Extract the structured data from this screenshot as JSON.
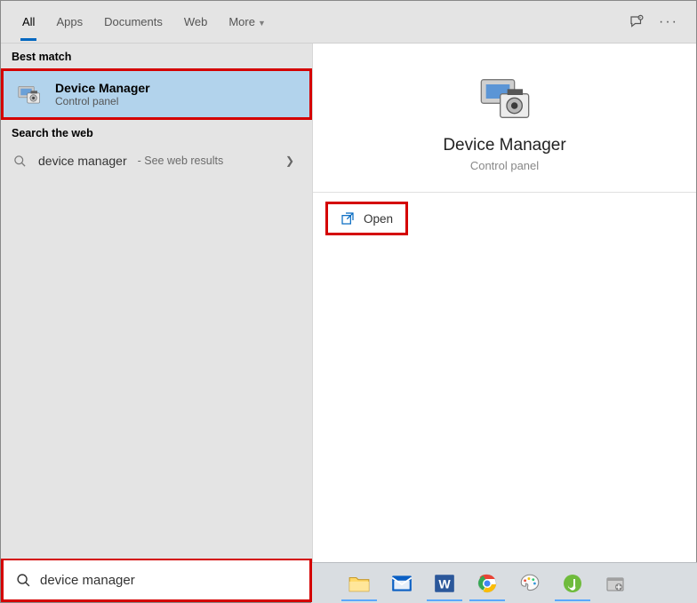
{
  "tabs": {
    "all": "All",
    "apps": "Apps",
    "documents": "Documents",
    "web": "Web",
    "more": "More"
  },
  "sections": {
    "best_match": "Best match",
    "search_web": "Search the web"
  },
  "best_match": {
    "title": "Device Manager",
    "subtitle": "Control panel"
  },
  "web_result": {
    "query": "device manager",
    "suffix": "- See web results"
  },
  "preview": {
    "title": "Device Manager",
    "subtitle": "Control panel"
  },
  "actions": {
    "open": "Open"
  },
  "search": {
    "value": "device manager"
  }
}
